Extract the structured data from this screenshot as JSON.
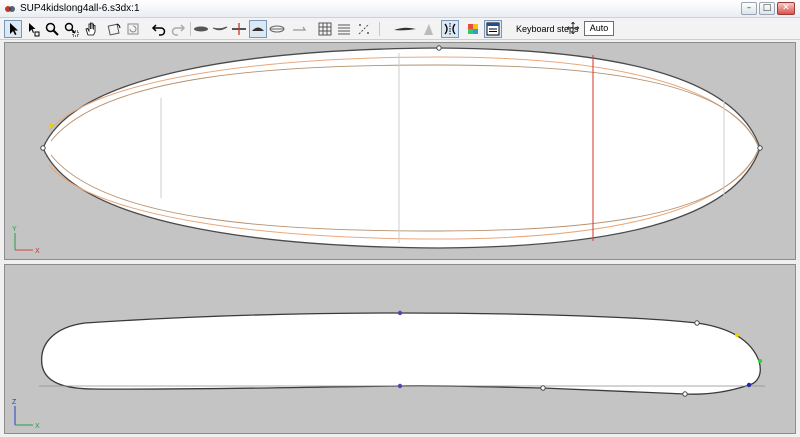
{
  "window": {
    "title": "SUP4kidslong4all-6.s3dx:1",
    "controls": {
      "minimize": "–",
      "maximize": "□",
      "close": "✕"
    }
  },
  "toolbar": {
    "tools": [
      "select-arrow-icon",
      "select-point-icon",
      "zoom-icon",
      "zoom-window-icon",
      "pan-hand-icon",
      "rotate-view-icon",
      "reset-view-icon",
      "undo-icon",
      "redo-icon",
      "outline-view-icon",
      "rocker-view-icon",
      "slice-view-icon",
      "board-3d-view-icon",
      "rails-view-icon",
      "deck-view-icon",
      "grid-icon",
      "slices-icon",
      "guides-icon",
      "bottom-view-icon",
      "fins-icon",
      "symmetry-icon",
      "color-palette-icon",
      "properties-panel-icon"
    ],
    "keyboard_steps_label": "Keyboard steps",
    "keyboard_steps_value": "Auto",
    "accent_color": "#7a96b8"
  },
  "top_view": {
    "axis_x_label": "X",
    "axis_y_label": "Y",
    "colors": {
      "background": "#c4c4c4",
      "board_fill": "#ffffff",
      "outline": "#4a4a4a",
      "guide_curve": "#e8a87c",
      "section_line_active": "#d9443a",
      "section_line": "#cccccc"
    }
  },
  "side_view": {
    "axis_z_label": "Z",
    "axis_x_label": "X",
    "colors": {
      "background": "#c4c4c4",
      "board_fill": "#ffffff",
      "outline": "#3a3a3a",
      "control_point_blue": "#2a2aa8",
      "control_point_green": "#2ecc40",
      "control_point_yellow": "#e6d200"
    }
  }
}
